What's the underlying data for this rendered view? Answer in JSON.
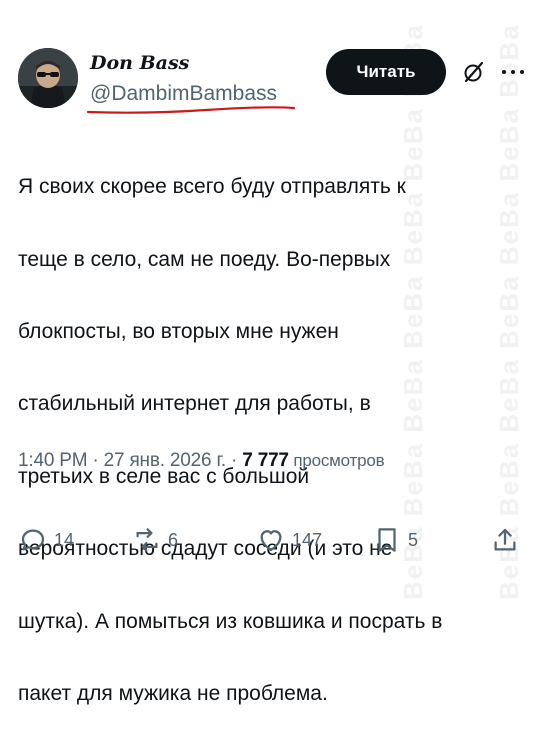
{
  "author": {
    "display_name": "Don Bass",
    "handle": "@DambimBambass"
  },
  "header": {
    "read_label": "Читать",
    "more_label": "···"
  },
  "tweet": {
    "lines": [
      "Я своих скорее всего буду отправлять к",
      "теще в село, сам не поеду. Во-первых",
      "блокпосты, во вторых мне нужен",
      "стабильный интернет для работы, в",
      "третьих в селе вас с большой",
      "вероятностью сдадут соседи (и это не",
      "шутка). А помыться из ковшика и посрать в",
      "пакет для мужика не проблема."
    ]
  },
  "meta": {
    "time": "1:40 PM",
    "sep1": " · ",
    "date": "27 янв. 2026 г.",
    "sep2": " · ",
    "views": "7 777",
    "views_label": " просмотров"
  },
  "actions": {
    "replies": "14",
    "reposts": "6",
    "likes": "147",
    "bookmarks": "5"
  },
  "watermark": "BeBa BeBa BeBa BeBa BeBa BeBa BeBa",
  "colors": {
    "text": "#0f1419",
    "secondary": "#536471",
    "button_bg": "#0f1419",
    "annotation_red": "#cc1a1a"
  }
}
